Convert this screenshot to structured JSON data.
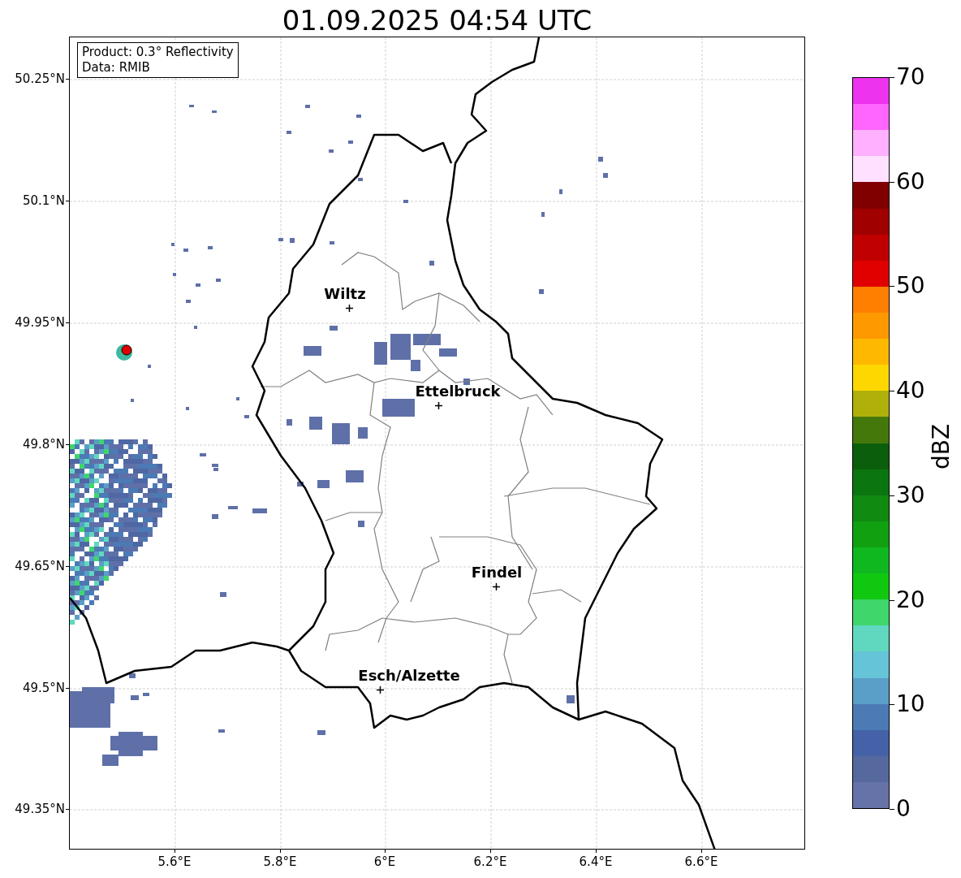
{
  "title": "01.09.2025 04:54 UTC",
  "info_box": {
    "lines": [
      "Product: 0.3° Reflectivity",
      "Data: RMIB"
    ]
  },
  "cities": [
    {
      "name": "Wiltz"
    },
    {
      "name": "Ettelbruck"
    },
    {
      "name": "Findel"
    },
    {
      "name": "Esch/Alzette"
    }
  ],
  "y_ticks": [
    "50.25°N",
    "50.1°N",
    "49.95°N",
    "49.8°N",
    "49.65°N",
    "49.5°N",
    "49.35°N"
  ],
  "x_ticks": [
    "5.6°E",
    "5.8°E",
    "6°E",
    "6.2°E",
    "6.4°E",
    "6.6°E"
  ],
  "colorbar": {
    "label": "dBZ",
    "ticks": [
      "70",
      "60",
      "50",
      "40",
      "30",
      "20",
      "10",
      "0"
    ],
    "bands": [
      {
        "color": "#ee33ee"
      },
      {
        "color": "#ff66ff"
      },
      {
        "color": "#ffb0ff"
      },
      {
        "color": "#ffe0ff"
      },
      {
        "color": "#800000"
      },
      {
        "color": "#a00000"
      },
      {
        "color": "#c00000"
      },
      {
        "color": "#e00000"
      },
      {
        "color": "#ff7f00"
      },
      {
        "color": "#ff9900"
      },
      {
        "color": "#ffb800"
      },
      {
        "color": "#ffd700"
      },
      {
        "color": "#b0b00a"
      },
      {
        "color": "#45780b"
      },
      {
        "color": "#0b5e0b"
      },
      {
        "color": "#0b7510"
      },
      {
        "color": "#108a10"
      },
      {
        "color": "#10a010"
      },
      {
        "color": "#10b820"
      },
      {
        "color": "#10c810"
      },
      {
        "color": "#3fd66c"
      },
      {
        "color": "#60d8c0"
      },
      {
        "color": "#66c4d8"
      },
      {
        "color": "#5a9fc8"
      },
      {
        "color": "#4b7ab5"
      },
      {
        "color": "#4562a8"
      },
      {
        "color": "#56699f"
      },
      {
        "color": "#6673a8"
      }
    ]
  }
}
